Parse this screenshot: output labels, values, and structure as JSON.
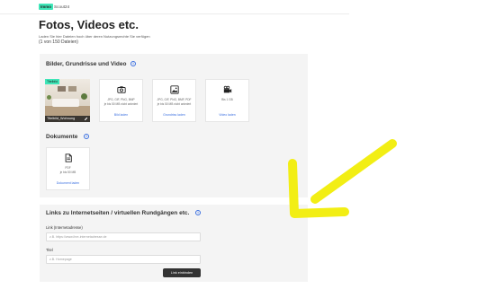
{
  "logo": {
    "badge": "Immo",
    "text": "Scout24"
  },
  "page": {
    "title": "Fotos, Videos etc.",
    "subtitle": "Laden Sie hier Dateien hoch über deren Nutzungsrechte Sie verfügen",
    "count": "(1 von 150 Dateien)"
  },
  "media": {
    "title": "Bilder, Grundrisse und Video",
    "photo": {
      "badge": "Titelbild",
      "caption": "Titelbild_Wohnung"
    },
    "tiles": [
      {
        "icon": "camera-icon",
        "formats": "JPG, GIF, PNG, BMP",
        "limit": "je bis 50 MB nicht animiert",
        "link": "Bild laden"
      },
      {
        "icon": "image-icon",
        "formats": "JPG, GIF, PNG, BMP, PDF",
        "limit": "je bis 50 MB nicht animiert",
        "link": "Grundriss laden"
      },
      {
        "icon": "video-camera-icon",
        "formats": "",
        "limit": "Bis 1 GB",
        "link": "Video laden"
      }
    ]
  },
  "documents": {
    "title": "Dokumente",
    "tile": {
      "icon": "document-icon",
      "formats": "PDF",
      "limit": "je bis 50 MB",
      "link": "Dokument laden"
    }
  },
  "links": {
    "title": "Links zu Internetseiten / virtuellen Rundgängen etc.",
    "url_label": "Link (Internetadresse)",
    "url_placeholder": "z.B. https://www.ihre-internetadresse.de",
    "title_label": "Titel",
    "title_placeholder": "z.B. Homepage",
    "button": "Link einbinden"
  },
  "colors": {
    "accent": "#3ee6b8",
    "link": "#3a6fe0",
    "annotation_arrow": "#f2ee14"
  }
}
